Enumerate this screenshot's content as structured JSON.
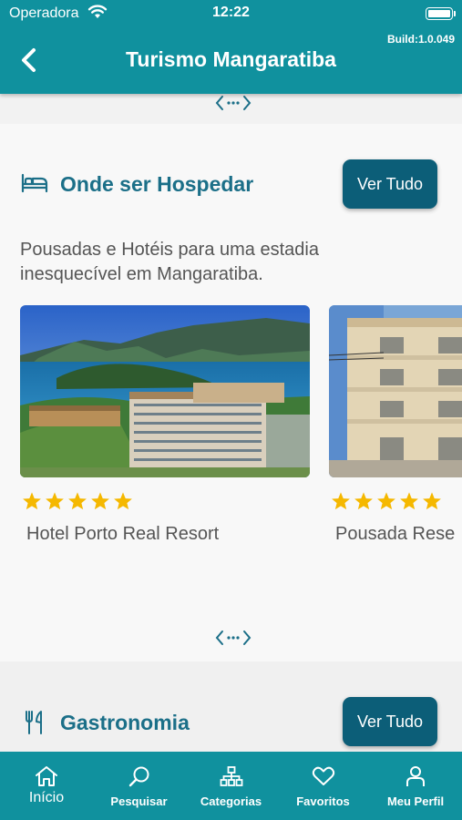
{
  "status_bar": {
    "carrier": "Operadora",
    "time": "12:22"
  },
  "header": {
    "build": "Build:1.0.049",
    "title": "Turismo Mangaratiba"
  },
  "lodging": {
    "title": "Onde ser Hospedar",
    "see_all": "Ver Tudo",
    "description": "Pousadas e Hotéis para uma estadia inesquecível em Mangaratiba.",
    "cards": [
      {
        "name": "Hotel Porto Real Resort",
        "rating": 5
      },
      {
        "name": "Pousada Rese",
        "rating": 5
      }
    ]
  },
  "food": {
    "title": "Gastronomia",
    "see_all": "Ver Tudo"
  },
  "tabbar": {
    "tabs": [
      {
        "label": "Início",
        "icon": "home-icon",
        "active": true
      },
      {
        "label": "Pesquisar",
        "icon": "search-icon"
      },
      {
        "label": "Categorias",
        "icon": "categories-icon"
      },
      {
        "label": "Favoritos",
        "icon": "heart-icon"
      },
      {
        "label": "Meu Perfil",
        "icon": "user-icon"
      }
    ]
  },
  "colors": {
    "primary": "#10919e",
    "button": "#0c5e78",
    "title": "#1b6f88",
    "star": "#f5b800"
  }
}
